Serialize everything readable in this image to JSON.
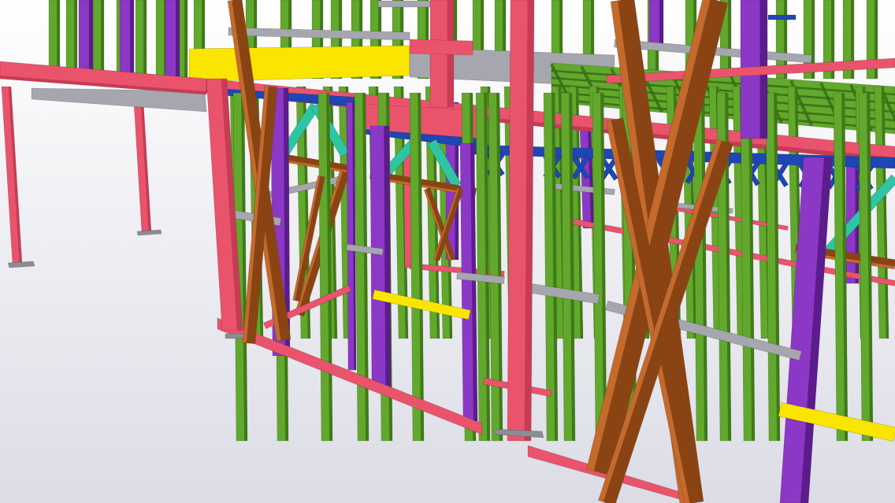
{
  "scene": {
    "subject": "steel-frame-3d-model",
    "colors": {
      "background_top": "#ffffff",
      "background_bottom": "#dcdce6",
      "floor_shadow": "#c9c9d3",
      "red_frame": "#e9546c",
      "red_frame_dark": "#c63c54",
      "green_stud": "#62a82c",
      "green_stud_dark": "#3f7a18",
      "purple_column": "#8c38c6",
      "purple_column_dark": "#5c1c8c",
      "brown_brace": "#c46a2c",
      "brown_brace_dark": "#8a4414",
      "blue_joist": "#1e46b4",
      "cyan_truss": "#2ec6a2",
      "yellow_beam": "#fae500",
      "grey_plate": "#a6a6ae",
      "base_plate": "#8c8c94"
    }
  }
}
